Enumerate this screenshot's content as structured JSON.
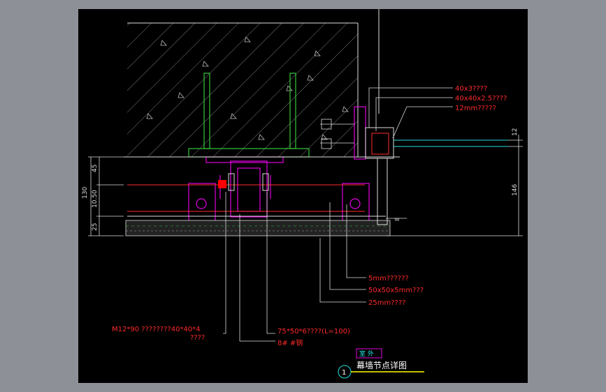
{
  "colors": {
    "background": "#8e9097",
    "canvas": "#000000",
    "annotation": "#ff2a2a",
    "magenta": "#e000e0",
    "green": "#35c83a",
    "cyan": "#28e0e0",
    "white": "#ffffff",
    "yellow": "#ffff00"
  },
  "callouts_top": {
    "aluminum_angle": "40x3????",
    "square_tube": "40x40x2.5????",
    "glass": "12mm?????"
  },
  "callouts_bottom": {
    "insulation": "5mm??????",
    "steel_angle": "50x50x5mm???",
    "stone": "25mm????"
  },
  "callouts_left": {
    "bolt": "M12*90  ????????40*40*4",
    "bolt_cont": "????",
    "channel": "75*50*6????(L=100)",
    "channel_steel": "8# #钢"
  },
  "dimensions": {
    "left_total": "130",
    "left_top": "45",
    "left_mid": "10.50",
    "left_bottom": "25",
    "right_small": "12",
    "right_total": "146",
    "right_gap": "8"
  },
  "labels": {
    "section_tag": "室 外",
    "detail_number": "1",
    "title": "幕墙节点详图"
  },
  "icons": {
    "bolt": "hex-bolt-icon",
    "anchor": "anchor-bolt-icon"
  }
}
